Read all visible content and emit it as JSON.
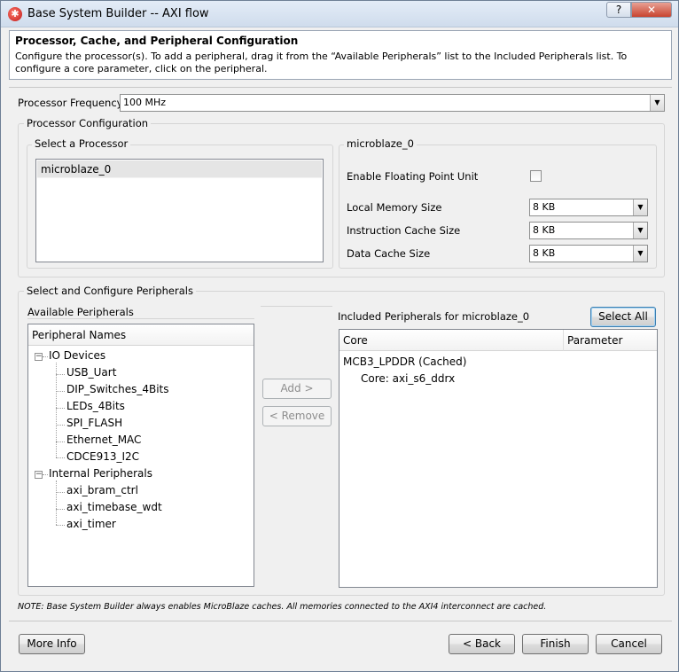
{
  "window": {
    "title": "Base System Builder -- AXI flow",
    "help_label": "?",
    "close_label": "✕"
  },
  "header": {
    "title": "Processor, Cache, and Peripheral Configuration",
    "description": "Configure the processor(s). To add a peripheral, drag it from the “Available Peripherals” list to the Included Peripherals list. To configure a core parameter, click on the peripheral."
  },
  "processor_frequency": {
    "label": "Processor Frequency",
    "value": "100 MHz"
  },
  "processor_config": {
    "group_title": "Processor Configuration",
    "select_label": "Select a Processor",
    "processors": [
      "microblaze_0"
    ],
    "detail_title": "microblaze_0",
    "fpu_label": "Enable Floating Point Unit",
    "fpu_checked": false,
    "local_memory_label": "Local Memory Size",
    "local_memory_value": "8 KB",
    "icache_label": "Instruction Cache Size",
    "icache_value": "8 KB",
    "dcache_label": "Data Cache Size",
    "dcache_value": "8 KB"
  },
  "peripherals": {
    "group_title": "Select and Configure Peripherals",
    "available_label": "Available Peripherals",
    "available_header": "Peripheral Names",
    "groups": [
      {
        "name": "IO Devices",
        "expander": "−",
        "items": [
          "USB_Uart",
          "DIP_Switches_4Bits",
          "LEDs_4Bits",
          "SPI_FLASH",
          "Ethernet_MAC",
          "CDCE913_I2C"
        ]
      },
      {
        "name": "Internal Peripherals",
        "expander": "−",
        "items": [
          "axi_bram_ctrl",
          "axi_timebase_wdt",
          "axi_timer"
        ]
      }
    ],
    "add_label": "Add >",
    "remove_label": "< Remove",
    "included_label": "Included Peripherals for microblaze_0",
    "select_all_label": "Select All",
    "included_columns": [
      "Core",
      "Parameter"
    ],
    "included_items": [
      {
        "name": "MCB3_LPDDR (Cached)",
        "core": "Core: axi_s6_ddrx"
      }
    ]
  },
  "note": "NOTE: Base System Builder always enables MicroBlaze caches.  All memories connected to the AXI4 interconnect are cached.",
  "footer": {
    "more_info_label": "More Info",
    "back_label": "< Back",
    "finish_label": "Finish",
    "cancel_label": "Cancel"
  }
}
